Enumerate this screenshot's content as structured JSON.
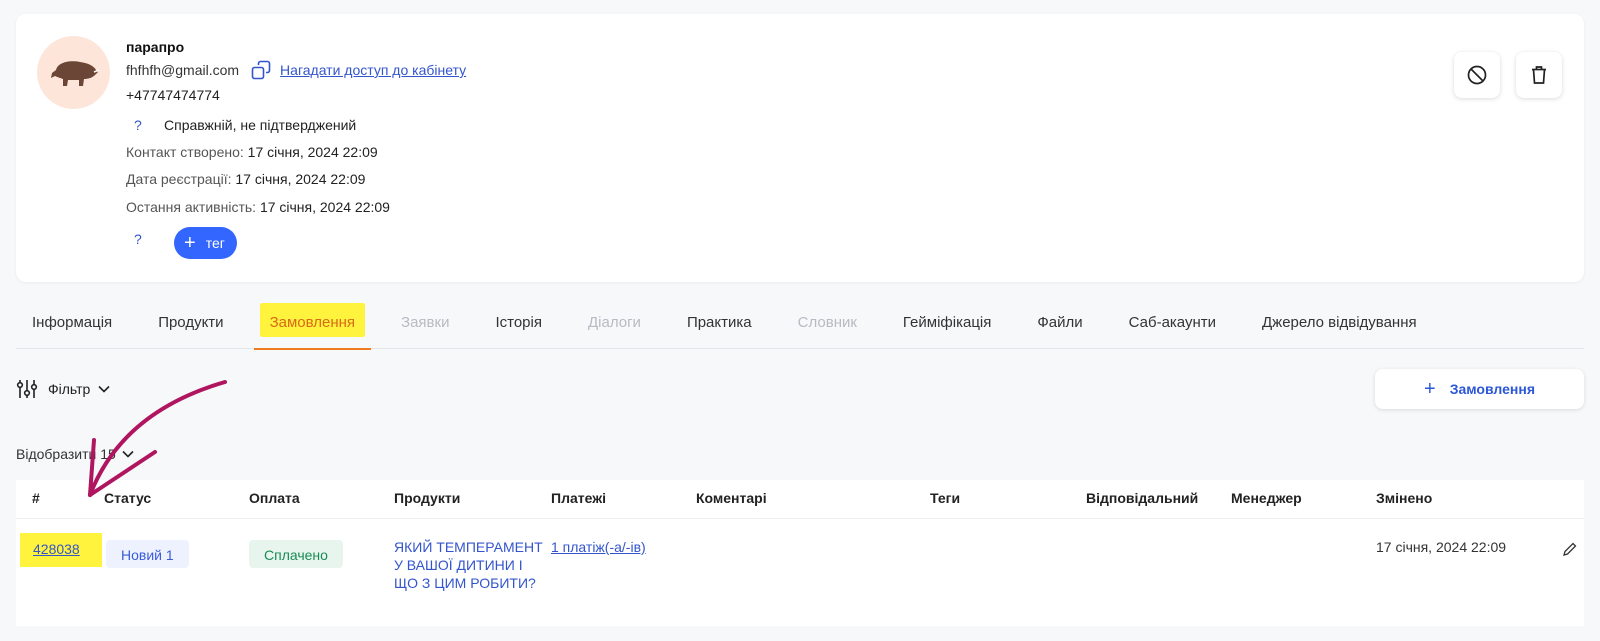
{
  "contact": {
    "name": "парапро",
    "email": "fhfhfh@gmail.com",
    "remind_link": "Нагадати доступ до кабінету",
    "phone": "+47747474774",
    "status_q": "?",
    "status": "Справжній, не підтверджений",
    "created_label": "Контакт створено:",
    "created_value": "17 січня, 2024 22:09",
    "registered_label": "Дата реєстрації:",
    "registered_value": "17 січня, 2024 22:09",
    "last_activity_label": "Остання активність:",
    "last_activity_value": "17 січня, 2024 22:09",
    "tag_q": "?",
    "tag_button": "тег"
  },
  "tabs": [
    {
      "label": "Інформація"
    },
    {
      "label": "Продукти"
    },
    {
      "label": "Замовлення"
    },
    {
      "label": "Заявки"
    },
    {
      "label": "Історія"
    },
    {
      "label": "Діалоги"
    },
    {
      "label": "Практика"
    },
    {
      "label": "Словник"
    },
    {
      "label": "Гейміфікація"
    },
    {
      "label": "Файли"
    },
    {
      "label": "Саб-акаунти"
    },
    {
      "label": "Джерело відвідування"
    }
  ],
  "toolbar": {
    "filter_label": "Фільтр",
    "add_order_label": "Замовлення",
    "display_label": "Відобразити 15"
  },
  "table": {
    "headers": [
      "#",
      "Статус",
      "Оплата",
      "Продукти",
      "Платежі",
      "Коментарі",
      "Теги",
      "Відповідальний",
      "Менеджер",
      "Змінено"
    ],
    "rows": [
      {
        "id": "428038",
        "status": "Новий 1",
        "payment": "Сплачено",
        "product": "ЯКИЙ ТЕМПЕРАМЕНТ У ВАШОЇ ДИТИНИ І ЩО З ЦИМ РОБИТИ?",
        "payments_link": "1 платіж(-а/-ів)",
        "changed": "17 січня, 2024 22:09"
      }
    ]
  },
  "colors": {
    "accent": "#3366ff",
    "active_tab": "#f07a1f",
    "highlight": "#fff33d",
    "annotation": "#b0155f"
  }
}
